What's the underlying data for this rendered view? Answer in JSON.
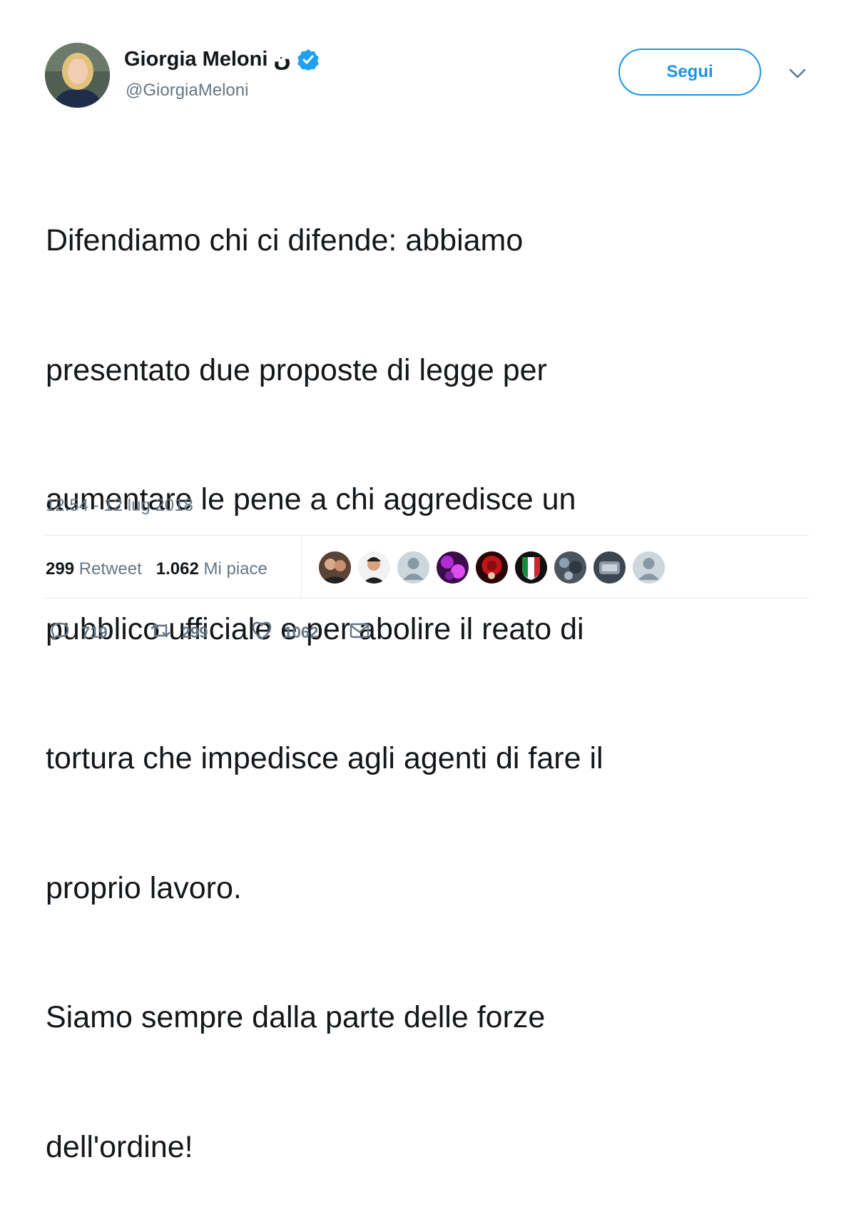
{
  "author": {
    "display_name": "Giorgia Meloni",
    "name_suffix": "ن",
    "handle": "@GiorgiaMeloni",
    "verified": true
  },
  "follow_button": {
    "label": "Segui"
  },
  "tweet": {
    "lines": [
      "Difendiamo chi ci difende: abbiamo",
      "presentato due proposte di legge per",
      "aumentare le pene a chi aggredisce un",
      "pubblico ufficiale e per abolire il reato di",
      "tortura che impedisce agli agenti di fare il",
      "proprio lavoro.",
      "Siamo sempre dalla parte delle forze",
      "dell'ordine!"
    ],
    "timestamp": "12:54 - 12 lug 2018"
  },
  "stats": {
    "retweets_count": "299",
    "retweets_label": "Retweet",
    "likes_count": "1.062",
    "likes_label": "Mi piace"
  },
  "liker_avatars": [
    {
      "icon": "user-avatar"
    },
    {
      "icon": "user-avatar"
    },
    {
      "icon": "default-avatar"
    },
    {
      "icon": "user-avatar"
    },
    {
      "icon": "user-avatar"
    },
    {
      "icon": "italy-flag-avatar"
    },
    {
      "icon": "user-avatar"
    },
    {
      "icon": "user-avatar"
    },
    {
      "icon": "default-avatar"
    }
  ],
  "actions": {
    "reply_count": "719",
    "retweet_count": "299",
    "like_count": "1062"
  },
  "colors": {
    "accent": "#1b95e0",
    "text": "#14171a",
    "secondary": "#657786",
    "divider": "#e6ecf0"
  }
}
